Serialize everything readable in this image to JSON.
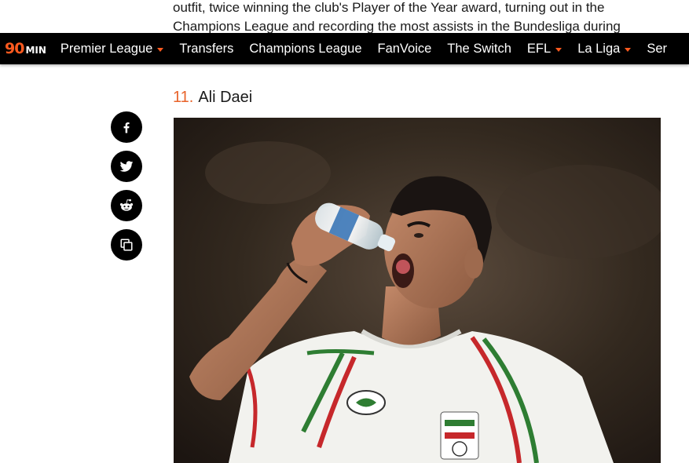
{
  "article": {
    "line1": "outfit, twice winning the club's Player of the Year award, turning out in the",
    "line2": "Champions League and recording the most assists in the Bundesliga during"
  },
  "header": {
    "logo_number": "90",
    "logo_suffix": "MIN",
    "nav_items": [
      {
        "label": "Premier League",
        "has_dropdown": true
      },
      {
        "label": "Transfers",
        "has_dropdown": false
      },
      {
        "label": "Champions League",
        "has_dropdown": false
      },
      {
        "label": "FanVoice",
        "has_dropdown": false
      },
      {
        "label": "The Switch",
        "has_dropdown": false
      },
      {
        "label": "EFL",
        "has_dropdown": true
      },
      {
        "label": "La Liga",
        "has_dropdown": true
      },
      {
        "label": "Ser",
        "has_dropdown": false
      }
    ]
  },
  "share": {
    "icons": [
      "facebook-icon",
      "twitter-icon",
      "reddit-icon",
      "copy-link-icon"
    ]
  },
  "section": {
    "rank": "11.",
    "title": "Ali Daei"
  },
  "photo": {
    "subject": "footballer drinking from water bottle"
  },
  "colors": {
    "accent": "#e8632a",
    "navbar_bg": "#000000",
    "share_btn_bg": "#000000"
  }
}
